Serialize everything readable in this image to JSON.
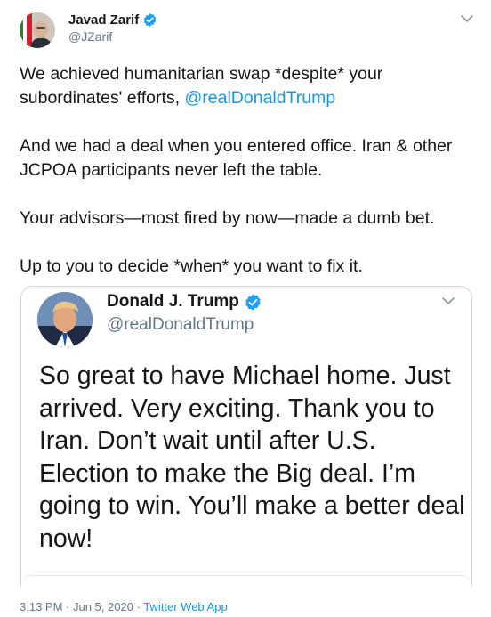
{
  "tweet": {
    "author": {
      "name": "Javad Zarif",
      "handle": "@JZarif"
    },
    "body": {
      "p1_before": "We achieved humanitarian swap *despite* your subordinates' efforts, ",
      "p1_mention": "@realDonaldTrump",
      "p2": "And we had a deal when you entered office. Iran & other JCPOA participants never left the table.",
      "p3": "Your advisors—most fired by now—made a dumb bet.",
      "p4": "Up to you to decide *when* you want to fix it."
    },
    "footer": {
      "time": "3:13 PM",
      "sep1": " · ",
      "date": "Jun 5, 2020",
      "sep2": " · ",
      "app": "Twitter Web App"
    }
  },
  "quoted": {
    "author": {
      "name": "Donald J. Trump",
      "handle": "@realDonaldTrump"
    },
    "text": "So great to have Michael home. Just arrived. Very exciting. Thank you to Iran. Don’t wait until after U.S. Election to make the Big deal. I’m going to win. You’ll make a better deal now!"
  },
  "icons": {
    "verified": "verified-badge-icon",
    "caret": "chevron-down-icon"
  },
  "colors": {
    "link": "#1b95e0",
    "secondary_text": "#657786",
    "border": "#ccd6dd",
    "verified": "#1da1f2"
  }
}
